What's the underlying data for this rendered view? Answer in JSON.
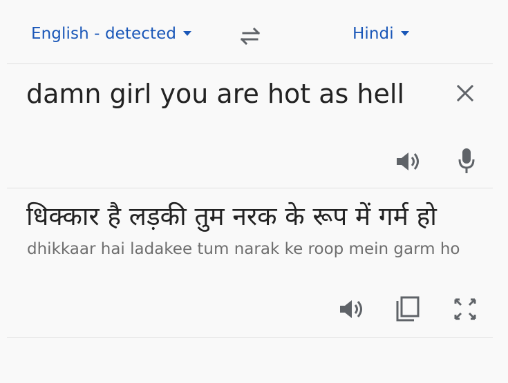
{
  "languages": {
    "source": "English - detected",
    "target": "Hindi"
  },
  "input": {
    "text": "damn girl you are hot as hell"
  },
  "output": {
    "text": "धिक्कार है लड़की तुम नरक के रूप में गर्म हो",
    "transliteration": "dhikkaar hai ladakee tum narak ke roop mein garm ho"
  },
  "icons": {
    "swap": "swap-arrows-icon",
    "clear": "close-icon",
    "source_speaker": "speaker-icon",
    "mic": "microphone-icon",
    "target_speaker": "speaker-icon",
    "copy": "copy-icon",
    "fullscreen": "fullscreen-icon"
  },
  "colors": {
    "accent": "#1a57b8",
    "icon": "#5f6368",
    "text": "#222222",
    "secondary_text": "#6e6e6e"
  }
}
